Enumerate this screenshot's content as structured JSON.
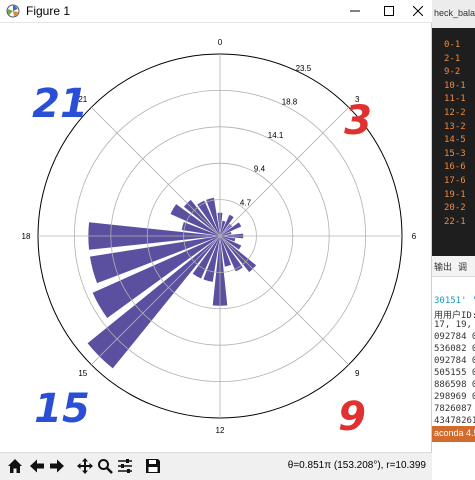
{
  "window": {
    "title": "Figure 1"
  },
  "chart_data": {
    "type": "polar-bar",
    "theta_unit": "hour",
    "theta_tick_labels": [
      "0",
      "3",
      "6",
      "9",
      "12",
      "15",
      "18",
      "21"
    ],
    "r_tick_values": [
      4.7,
      9.4,
      14.1,
      18.8,
      23.5
    ],
    "r_tick_labels": [
      "4.7",
      "9.4",
      "14.1",
      "18.8",
      "23.5"
    ],
    "rmax": 23.5,
    "bar_color": "#5b4fa0",
    "bars": [
      {
        "hour": 0,
        "r": 3
      },
      {
        "hour": 1,
        "r": 2
      },
      {
        "hour": 2,
        "r": 3
      },
      {
        "hour": 3,
        "r": 2
      },
      {
        "hour": 4,
        "r": 3
      },
      {
        "hour": 5,
        "r": 1.5
      },
      {
        "hour": 6,
        "r": 3
      },
      {
        "hour": 7,
        "r": 2
      },
      {
        "hour": 8,
        "r": 3
      },
      {
        "hour": 9,
        "r": 6
      },
      {
        "hour": 10,
        "r": 5
      },
      {
        "hour": 11,
        "r": 4
      },
      {
        "hour": 12,
        "r": 9
      },
      {
        "hour": 13,
        "r": 6
      },
      {
        "hour": 14,
        "r": 6
      },
      {
        "hour": 15,
        "r": 22
      },
      {
        "hour": 16,
        "r": 18
      },
      {
        "hour": 17,
        "r": 17
      },
      {
        "hour": 18,
        "r": 17
      },
      {
        "hour": 19,
        "r": 5
      },
      {
        "hour": 20,
        "r": 7
      },
      {
        "hour": 21,
        "r": 6
      },
      {
        "hour": 22,
        "r": 5
      },
      {
        "hour": 23,
        "r": 5
      }
    ],
    "grid": true
  },
  "annotations": [
    {
      "text": "21",
      "color": "#2a4fd6"
    },
    {
      "text": "3",
      "color": "#e03030"
    },
    {
      "text": "15",
      "color": "#2a4fd6"
    },
    {
      "text": "9",
      "color": "#e03030"
    }
  ],
  "toolbar": {
    "buttons": [
      "home-icon",
      "back-icon",
      "forward-icon",
      "pan-icon",
      "zoom-icon",
      "configure-icon",
      "save-icon"
    ],
    "coords_text": "θ=0.851π (153.208°), r=10.399"
  },
  "ide": {
    "tab_text": "heck_bala",
    "code_lines": [
      "0-1",
      "2-1",
      "9-2",
      "10-1",
      "11-1",
      "12-2",
      "13-2",
      "14-5",
      "15-3",
      "16-6",
      "17-6",
      "19-1",
      "20-2",
      "22-1"
    ],
    "panel_tabs": [
      "输出",
      "调"
    ],
    "output_lines": [
      "30151' '",
      "用用户ID:",
      "17, 19,",
      "092784 0",
      "536082 0",
      "092784 0",
      "505155 0",
      "886598 0",
      "298969 0",
      "7826087",
      "43478261"
    ],
    "status_text": "aconda 4.5"
  }
}
